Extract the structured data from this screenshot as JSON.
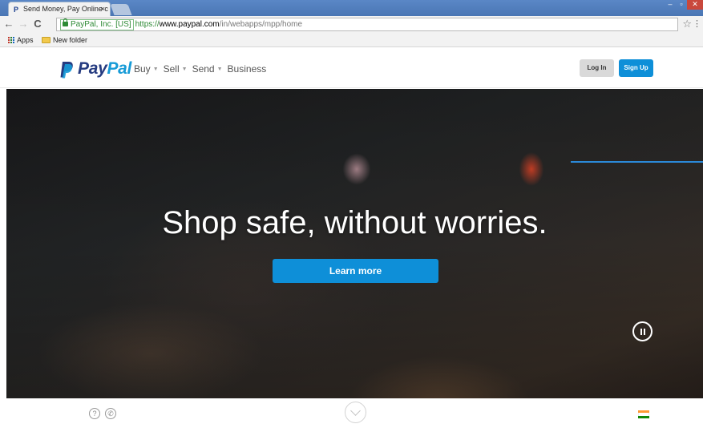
{
  "browser": {
    "tab_title": "Send Money, Pay Online c",
    "tab_close": "×",
    "ev_badge": "PayPal, Inc. [US]",
    "url_scheme": "https://",
    "url_host": "www.paypal.com",
    "url_path": "/in/webapps/mpp/home",
    "bookmarks": [
      {
        "label": "Apps"
      },
      {
        "label": "New folder"
      }
    ]
  },
  "header": {
    "logo_pay": "Pay",
    "logo_pal": "Pal",
    "nav": [
      {
        "label": "Buy"
      },
      {
        "label": "Sell"
      },
      {
        "label": "Send"
      },
      {
        "label": "Business"
      }
    ],
    "login_label": "Log In",
    "signup_label": "Sign Up"
  },
  "hero": {
    "headline": "Shop safe, without worries.",
    "cta_label": "Learn more"
  },
  "footer": {
    "help_glyph": "?",
    "phone_glyph": "✆"
  },
  "colors": {
    "paypal_dark_blue": "#253b80",
    "paypal_light_blue": "#179bd7",
    "button_blue": "#0e8fd8",
    "hero_accent_line": "#2b89d8"
  },
  "icons": [
    "paypal-logo-icon",
    "lock-icon",
    "star-icon",
    "apps-icon",
    "folder-icon",
    "pause-icon",
    "help-icon",
    "phone-icon",
    "chevron-down-icon",
    "india-flag-icon"
  ]
}
